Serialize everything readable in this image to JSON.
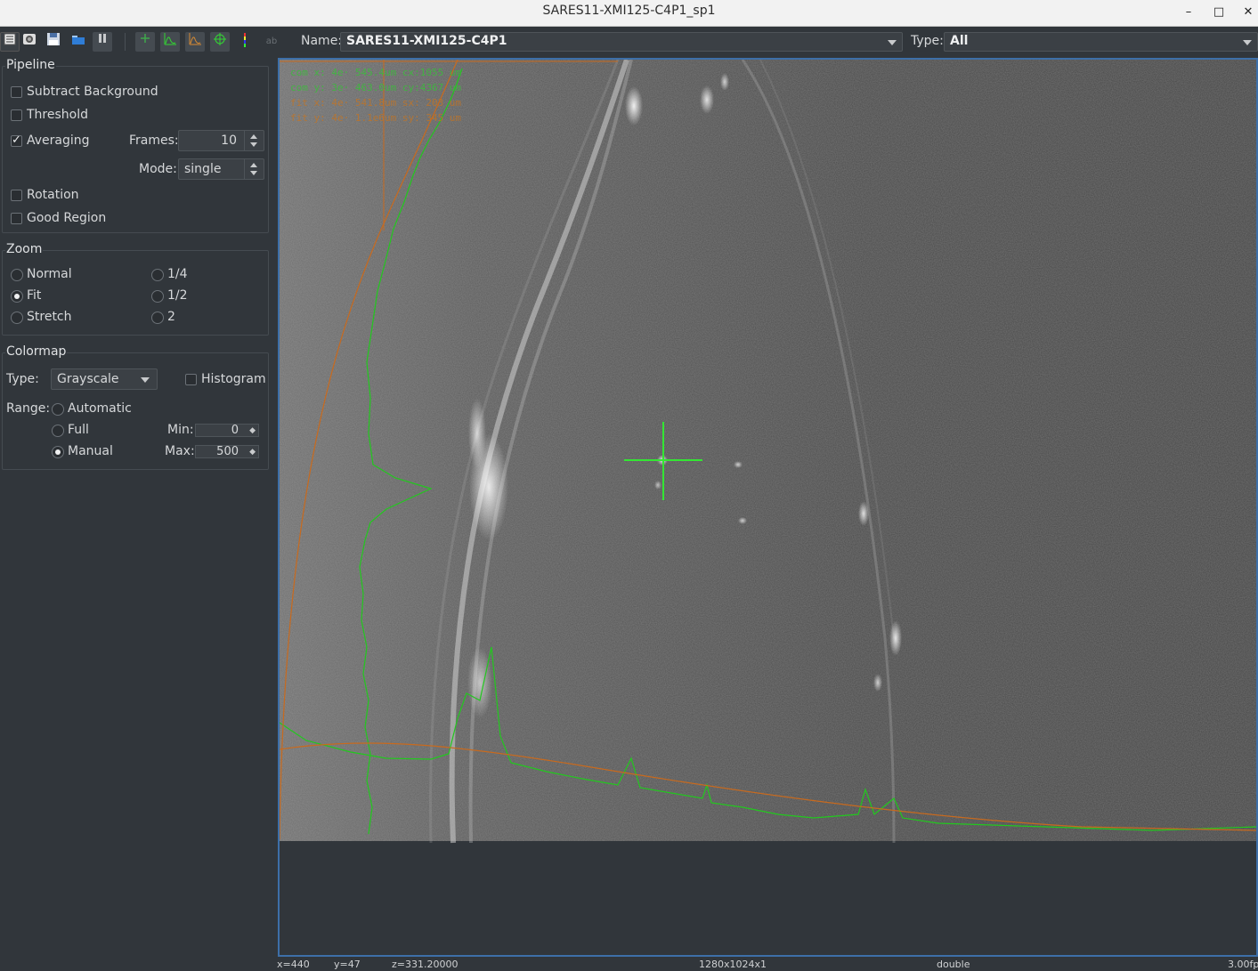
{
  "window": {
    "title": "SARES11-XMI125-C4P1_sp1",
    "minimize": "–",
    "maximize": "□",
    "close": "✕"
  },
  "toolbar": {
    "icons": [
      "list-icon",
      "camera-icon",
      "save-icon",
      "folder-icon",
      "pause-icon",
      "plus-icon",
      "x-projection-icon",
      "y-projection-icon",
      "crosshair-icon",
      "color-marker-icon",
      "text-label-icon"
    ],
    "text_icon": "ab",
    "name_label": "Name:",
    "name_value": "SARES11-XMI125-C4P1",
    "type_label": "Type:",
    "type_value": "All"
  },
  "pipeline": {
    "title": "Pipeline",
    "subtract_background": {
      "label": "Subtract Background",
      "checked": false
    },
    "threshold": {
      "label": "Threshold",
      "checked": false
    },
    "averaging": {
      "label": "Averaging",
      "checked": true
    },
    "frames_label": "Frames:",
    "frames_value": "10",
    "mode_label": "Mode:",
    "mode_value": "single",
    "rotation": {
      "label": "Rotation",
      "checked": false
    },
    "good_region": {
      "label": "Good Region",
      "checked": false
    }
  },
  "zoom": {
    "title": "Zoom",
    "options": [
      "Normal",
      "Fit",
      "Stretch",
      "1/4",
      "1/2",
      "2"
    ],
    "selected": "Fit"
  },
  "colormap": {
    "title": "Colormap",
    "type_label": "Type:",
    "type_value": "Grayscale",
    "histogram_label": "Histogram",
    "histogram_checked": false,
    "range_label": "Range:",
    "range_options": [
      "Automatic",
      "Full",
      "Manual"
    ],
    "range_selected": "Manual",
    "min_label": "Min:",
    "min_value": "0",
    "max_label": "Max:",
    "max_value": "500"
  },
  "overlay_text": {
    "line1": "com x: 4e·  545.4um  cx:1055 um",
    "line2": "com y: 3e·  463.0um  cy:4367 um",
    "line3": "fit x: 4e·  541.8um  sx: 203 um",
    "line4": "fit y: 4e·  1.1e6um  sy: 345 um"
  },
  "status": {
    "x": "x=440",
    "y": "y=47",
    "z": "z=331.20000",
    "size": "1280x1024x1",
    "dtype": "double",
    "fps": "3.00fps"
  },
  "colors": {
    "background": "#31363b",
    "accent_border": "#3d6fa8",
    "profile_green": "#22c81e",
    "fit_orange": "#c86a1e",
    "crosshair": "#33e633"
  }
}
